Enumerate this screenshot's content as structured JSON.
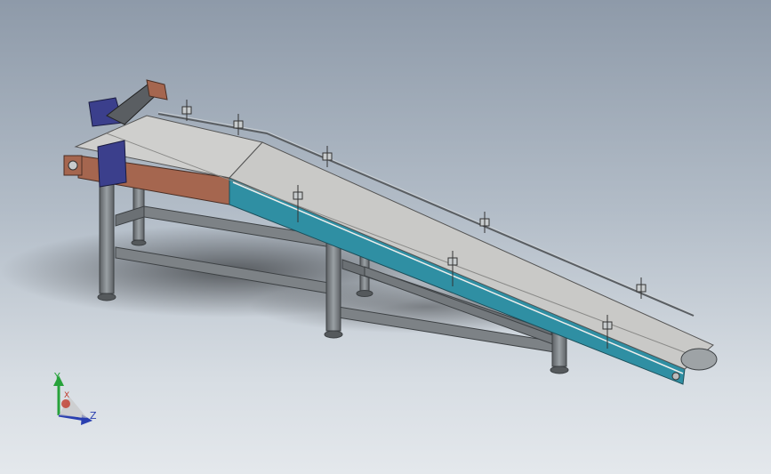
{
  "viewport": {
    "background_top": "#8e9aa9",
    "background_bottom": "#e4e8ec"
  },
  "model": {
    "belt_color": "#c9c9c7",
    "frame_color": "#6f7478",
    "side_panel_incline_color": "#2f8fa3",
    "side_panel_flat_color": "#a5664f",
    "motor_color": "#3b3f8c"
  },
  "triad": {
    "y_label": "Y",
    "x_label": "X",
    "z_label": "Z",
    "y_color": "#27a23a",
    "x_color": "#c0392b",
    "z_color": "#2a3fb0"
  }
}
